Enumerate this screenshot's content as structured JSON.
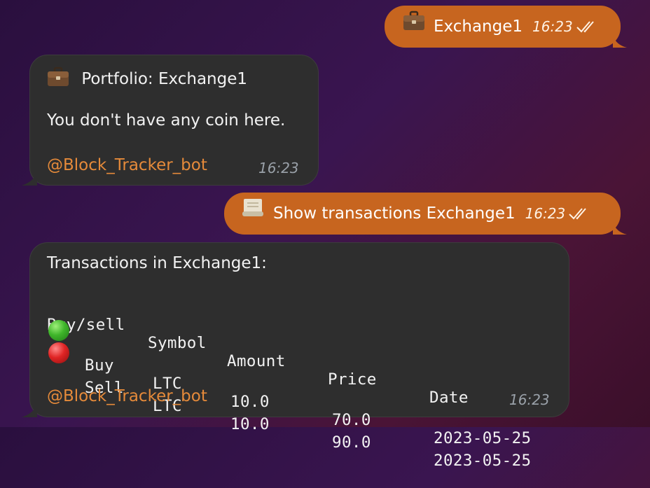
{
  "messages": {
    "out1": {
      "icon": "briefcase-icon",
      "text": "Exchange1",
      "time": "16:23"
    },
    "portfolio": {
      "icon": "briefcase-icon",
      "title": "Portfolio: Exchange1",
      "body": "You don't have any coin here.",
      "bot": "@Block_Tracker_bot",
      "time": "16:23"
    },
    "out2": {
      "icon": "scroll-icon",
      "text": "Show transactions Exchange1",
      "time": "16:23"
    },
    "transactions": {
      "title": "Transactions in Exchange1:",
      "headers": [
        "Buy/sell",
        "Symbol",
        "Amount",
        "Price",
        "Date"
      ],
      "rows": [
        {
          "status_icon": "green-circle-icon",
          "type": "Buy",
          "symbol": "LTC",
          "amount": "10.0",
          "price": "70.0",
          "date": "2023-05-25"
        },
        {
          "status_icon": "red-circle-icon",
          "type": "Sell",
          "symbol": "LTC",
          "amount": "10.0",
          "price": "90.0",
          "date": "2023-05-25"
        }
      ],
      "bot": "@Block_Tracker_bot",
      "time": "16:23"
    }
  },
  "colors": {
    "outgoing_bubble": "#c7651f",
    "incoming_bubble": "#2e2e2e",
    "link": "#e58a3a"
  }
}
